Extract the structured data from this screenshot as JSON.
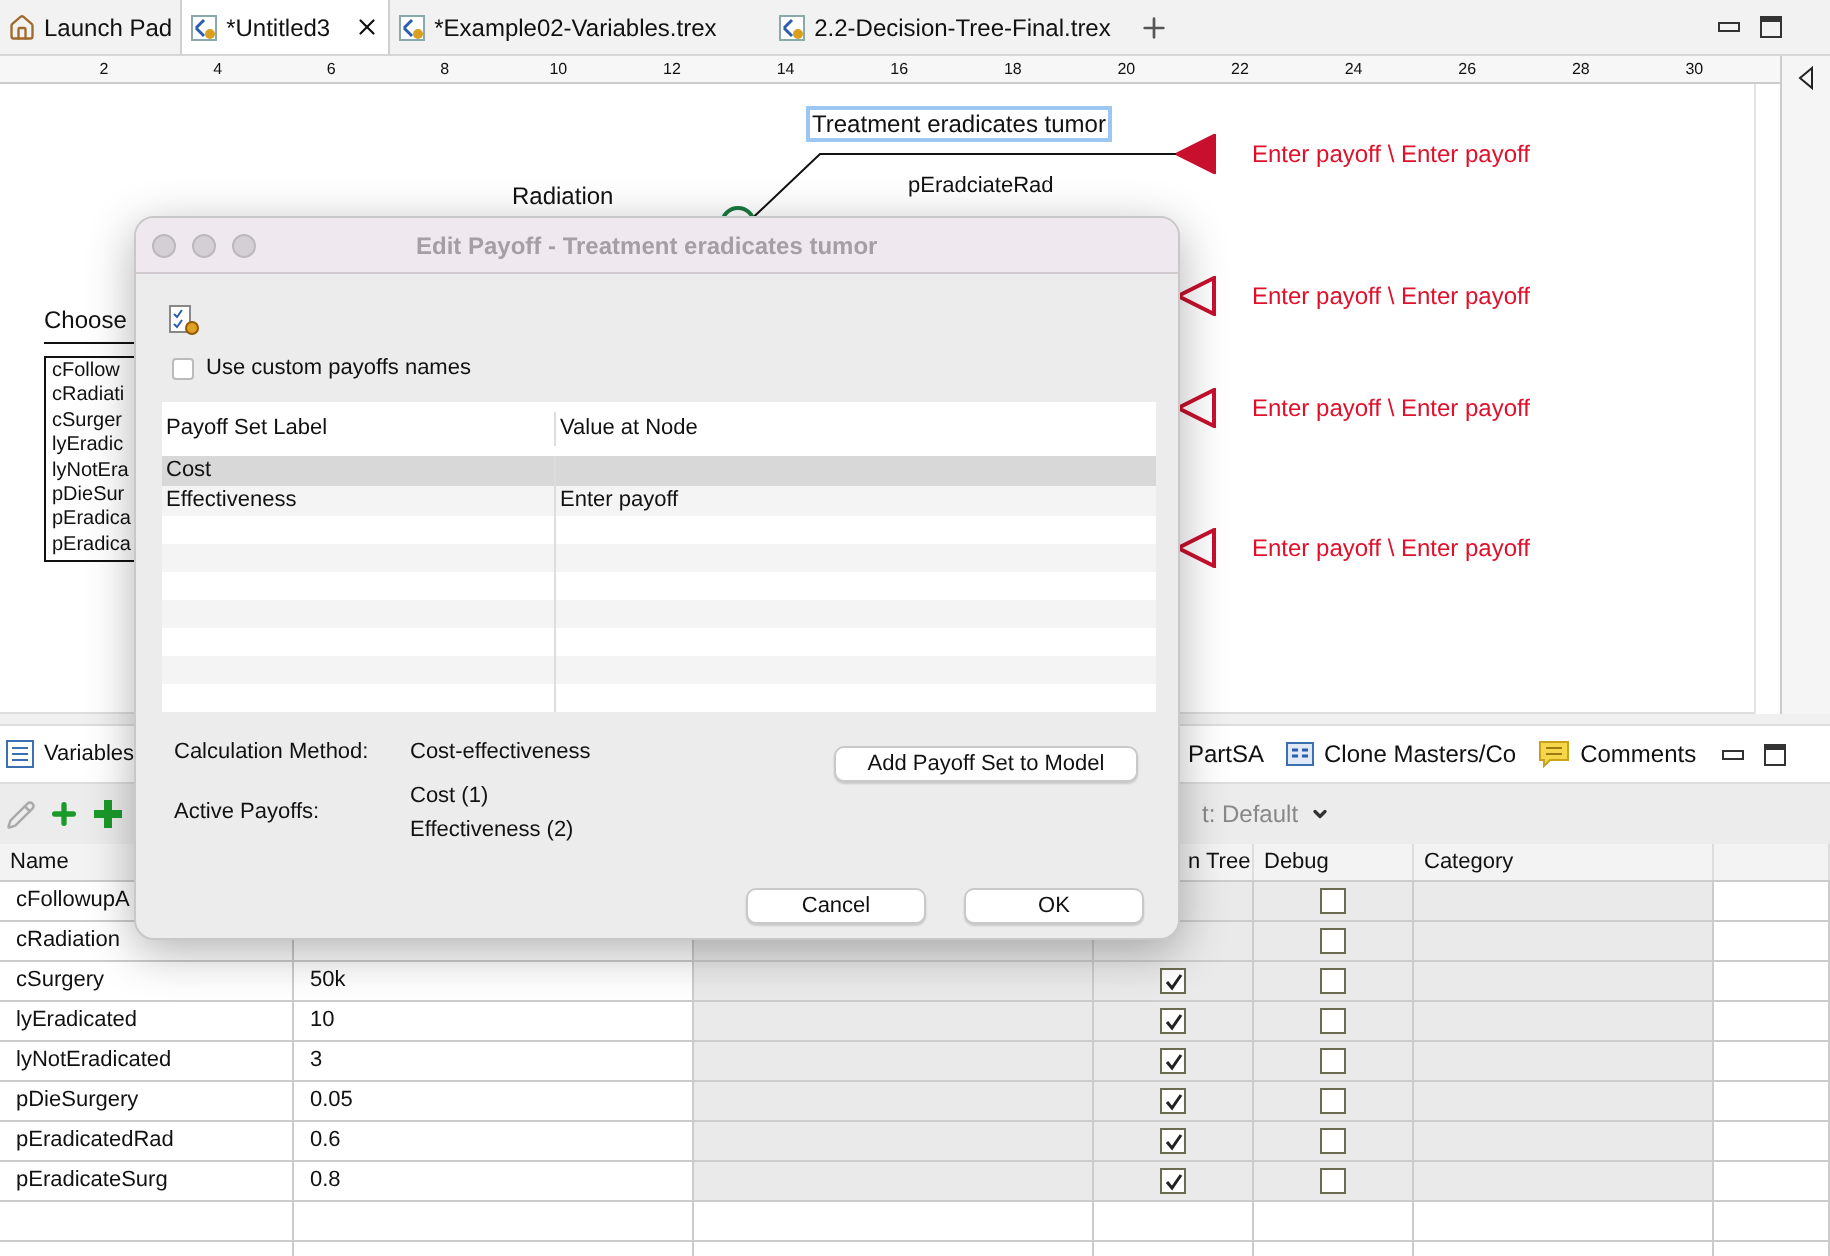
{
  "tabs": [
    {
      "label": "Launch Pad",
      "kind": "launcher",
      "selected": false,
      "closable": false
    },
    {
      "label": "*Untitled3",
      "kind": "file",
      "selected": true,
      "closable": true
    },
    {
      "label": "*Example02-Variables.trex",
      "kind": "file",
      "selected": false,
      "closable": false
    },
    {
      "label": "2.2-Decision-Tree-Final.trex",
      "kind": "file",
      "selected": false,
      "closable": false
    }
  ],
  "ruler": {
    "labels": [
      "2",
      "4",
      "6",
      "8",
      "10",
      "12",
      "14",
      "16",
      "18",
      "20",
      "22",
      "24",
      "26",
      "28",
      "30"
    ]
  },
  "canvas": {
    "branch_label": "Treatment eradicates tumor",
    "branch_probability": "pEradciateRad",
    "decision_branch": "Radiation",
    "choose_label": "Choose",
    "variable_list": [
      "cFollow",
      "cRadiati",
      "cSurger",
      "lyEradic",
      "lyNotEra",
      "pDieSur",
      "pEradica",
      "pEradica"
    ],
    "payoffs": [
      {
        "text": "Enter payoff \\ Enter payoff",
        "filled": true
      },
      {
        "text": "Enter payoff \\ Enter payoff",
        "filled": false
      },
      {
        "text": "Enter payoff \\ Enter payoff",
        "filled": false
      },
      {
        "text": "Enter payoff \\ Enter payoff",
        "filled": false
      }
    ]
  },
  "dialog": {
    "title": "Edit Payoff - Treatment eradicates tumor",
    "checkbox": {
      "label": "Use custom payoffs names",
      "checked": false
    },
    "table": {
      "columns": [
        "Payoff Set Label",
        "Value at Node"
      ],
      "rows": [
        {
          "cells": [
            "Cost"
          ],
          "selected": true
        },
        {
          "cells": [
            "Effectiveness",
            "Enter payoff"
          ],
          "selected": false
        }
      ]
    },
    "calculation_method_label": "Calculation Method:",
    "calculation_method": "Cost-effectiveness",
    "active_payoffs_label": "Active Payoffs:",
    "active_payoffs": [
      "Cost (1)",
      "Effectiveness (2)"
    ],
    "add_button": "Add Payoff Set to Model",
    "buttons": [
      "Cancel",
      "OK"
    ]
  },
  "bottom_panel": {
    "tabs": [
      {
        "label": "Variables"
      },
      {
        "label": "PartSA"
      },
      {
        "label": "Clone Masters/Co"
      },
      {
        "label": "Comments"
      }
    ],
    "filter": "t: Default",
    "table": {
      "columns": [
        {
          "label": "Name"
        },
        {},
        {},
        {
          "label": "n Tree"
        },
        {
          "label": "Debug"
        },
        {
          "label": "Category"
        },
        {}
      ],
      "rows": [
        {
          "name": "cFollowupA",
          "debug": false
        },
        {
          "name": "cRadiation",
          "debug": false
        },
        {
          "name": "cSurgery",
          "value": "50k",
          "in_tree": true,
          "debug": false
        },
        {
          "name": "lyEradicated",
          "value": "10",
          "in_tree": true,
          "debug": false
        },
        {
          "name": "lyNotEradicated",
          "value": "3",
          "in_tree": true,
          "debug": false
        },
        {
          "name": "pDieSurgery",
          "value": "0.05",
          "in_tree": true,
          "debug": false
        },
        {
          "name": "pEradicatedRad",
          "value": "0.6",
          "in_tree": true,
          "debug": false
        },
        {
          "name": "pEradicateSurg",
          "value": "0.8",
          "in_tree": true,
          "debug": false
        }
      ]
    }
  }
}
